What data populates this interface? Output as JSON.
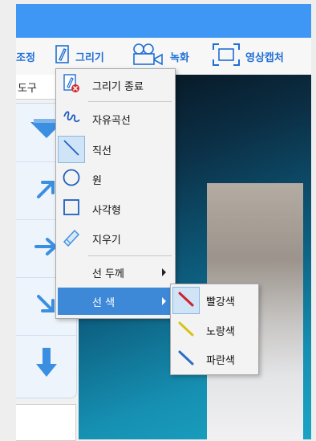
{
  "toolbar": {
    "adjust_label": "조정",
    "draw_label": "그리기",
    "record_label": "녹화",
    "capture_label": "영상캡처"
  },
  "left_panel": {
    "header": "도구",
    "arrows": [
      "down-arrow",
      "up-right-arrow",
      "right-arrow",
      "down-right-arrow",
      "down-thick-arrow"
    ]
  },
  "draw_menu": {
    "items": [
      {
        "label": "그리기 종료",
        "icon": "stop-drawing-icon"
      },
      {
        "label": "자유곡선",
        "icon": "freehand-curve-icon"
      },
      {
        "label": "직선",
        "icon": "straight-line-icon"
      },
      {
        "label": "원",
        "icon": "circle-icon"
      },
      {
        "label": "사각형",
        "icon": "rectangle-icon"
      },
      {
        "label": "지우기",
        "icon": "eraser-icon"
      },
      {
        "label": "선 두께",
        "icon": ""
      },
      {
        "label": "선 색",
        "icon": ""
      }
    ],
    "selected": "직선",
    "highlighted": "선 색"
  },
  "color_submenu": {
    "items": [
      {
        "label": "빨강색",
        "color": "#d0222b"
      },
      {
        "label": "노랑색",
        "color": "#d8c418"
      },
      {
        "label": "파란색",
        "color": "#2b6fc9"
      }
    ],
    "selected": "빨강색"
  },
  "colors": {
    "titlebar": "#3f97f5",
    "toolbar_text": "#1f6fd6",
    "menu_highlight": "#3d89d8",
    "arrow_blue": "#3b8fe0"
  }
}
